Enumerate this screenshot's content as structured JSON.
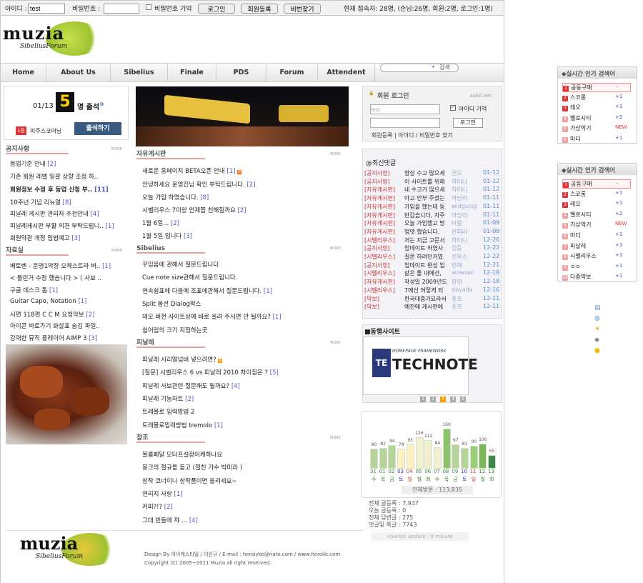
{
  "login_bar": {
    "id_label": "아이디 :",
    "id_value": "test",
    "pw_label": "비밀번호 :",
    "remember_label": "비밀번호 기억",
    "login_btn": "로그인",
    "join_btn": "회원등록",
    "find_btn": "비번찾기",
    "online": "현재 접속자: 28명, (손님:26명, 회원:2명, 로그인:1명)"
  },
  "logo": {
    "main": "muzia",
    "sub": "SibeliusForum"
  },
  "nav": [
    "Home",
    "About Us",
    "Sibelius",
    "Finale",
    "PDS",
    "Forum",
    "Attendent"
  ],
  "search_btn": "검색",
  "attend": {
    "date": "01/13",
    "count": "5",
    "suffix": "명 출석",
    "rank_no": "1등",
    "rank_name": "미주스코어닝",
    "button": "출석하기"
  },
  "more_label": "MORE",
  "notice": {
    "title": "공지사항",
    "items": [
      {
        "t": "등업기준 안내",
        "c": "[2]"
      },
      {
        "t": "기존 회원 레벨 일괄 상향 조정 하..",
        "c": ""
      },
      {
        "t": "회원정보 수정 후 등업 신청 부..",
        "c": "[11]"
      },
      {
        "t": "10주년 기념 리뉴얼",
        "c": "[8]"
      },
      {
        "t": "피날레 게시판 관리자 추천안내",
        "c": "[4]"
      },
      {
        "t": "피날레게시판 부활 의견 부탁드립니..",
        "c": "[1]"
      },
      {
        "t": "회원약관 개정 입법예고",
        "c": "[3]"
      }
    ]
  },
  "pds": {
    "title": "자료실",
    "items": [
      {
        "t": "베토벤 - 운명1악장 오케스트라 버..",
        "c": "[1]"
      },
      {
        "t": "< 틀린거 수정 했습니다 > ( 사보 ..",
        "c": ""
      },
      {
        "t": "구글 데스크 톱",
        "c": "[1]"
      },
      {
        "t": "Guitar Capo, Notation",
        "c": "[1]"
      },
      {
        "t": "시편 118편 C C M 요청악보",
        "c": "[2]"
      },
      {
        "t": "아이콘 바로가기 화살표 숨김 파일..",
        "c": ""
      },
      {
        "t": "강력한 뮤직 플레이어 AIMP 3",
        "c": "[3]"
      }
    ]
  },
  "free": {
    "title": "자유게시판",
    "items": [
      {
        "t": "새로운 홈페이지 BETA오픈 안내",
        "c": "[1]"
      },
      {
        "t": "안녕하세요 운영진님 확인 부탁드립니다.",
        "c": "[2]"
      },
      {
        "t": "오늘 가입 하였습니다.",
        "c": "[8]"
      },
      {
        "t": "시벨리우스 7이랑 언제쯤 친해질까요",
        "c": "[2]"
      },
      {
        "t": "1월 6일...",
        "c": "[2]"
      },
      {
        "t": "1월 5일 입니다",
        "c": "[3]"
      }
    ]
  },
  "sibelius": {
    "title": "Sibelius",
    "items": [
      {
        "t": "꾸밈음에 관해서 질문드립니다",
        "c": ""
      },
      {
        "t": "Cue note size관해서 질문드립니다.",
        "c": ""
      },
      {
        "t": "연속쉼표에 다음에 조표에관해서 질문드립니다.",
        "c": "[1]"
      },
      {
        "t": "Split 옵션 Dialog박스",
        "c": ""
      },
      {
        "t": "데모 버전 사이트상에 바로 올려 주시면 안 될까요?",
        "c": "[1]"
      },
      {
        "t": "쉼어림의 크기 지정하는곳",
        "c": ""
      }
    ]
  },
  "finale": {
    "title": "피날레",
    "items": [
      {
        "t": "피날레 시리얼넘버 넣으려면?",
        "c": ""
      },
      {
        "t": "[질문] 시벨리우스 6 vs 피날레 2010 차이점은 ?",
        "c": "[5]"
      },
      {
        "t": "피날레 사보관련 질문해도 될까요?",
        "c": "[4]"
      },
      {
        "t": "피날레 기능차트",
        "c": "[2]"
      },
      {
        "t": "트레몰로 입력방법 2",
        "c": ""
      },
      {
        "t": "트레몰로입력방법 tremolo",
        "c": "[1]"
      }
    ]
  },
  "creative": {
    "title": "창조",
    "items": [
      {
        "t": "볼륨페달 모터프설정어케하나요",
        "c": ""
      },
      {
        "t": "몽크의 절규를 듣고 (절친 가수 박미라 )",
        "c": ""
      },
      {
        "t": "창작 코너이니 창작품이면 올리세요~",
        "c": ""
      },
      {
        "t": "연리지 사랑",
        "c": "[1]"
      },
      {
        "t": "커피?!?",
        "c": "[2]"
      },
      {
        "t": "그대 빈들에 꺄 ...",
        "c": "[4]"
      }
    ]
  },
  "member_login": {
    "title": "회원 로그인",
    "site": "sukil.net",
    "id_value": "test",
    "remember": "아이디 기억",
    "button": "로그인",
    "links": "회원등록 | 아이디 / 비밀번호 찾기"
  },
  "recent_comments": {
    "title": "@최신댓글",
    "rows": [
      {
        "b": "[공지사항]",
        "t": "항상 수고 많으세",
        "u": "권오",
        "d": "01-12"
      },
      {
        "b": "[공지사항]",
        "t": "이 사이트를 위해",
        "u": "하미니",
        "d": "01-12"
      },
      {
        "b": "[자유게시판]",
        "t": "네 수고가 많으세",
        "u": "하미니",
        "d": "01-12"
      },
      {
        "b": "[자유게시판]",
        "t": "아고 안부 주셨는",
        "u": "마당리",
        "d": "01-11"
      },
      {
        "b": "[자유게시판]",
        "t": "가입을 했는데 등",
        "u": "widgusig",
        "d": "01-11"
      },
      {
        "b": "[자유게시판]",
        "t": "반갑습니다, 자주",
        "u": "마당리",
        "d": "01-11"
      },
      {
        "b": "[자유게시판]",
        "t": "오늘 가입했고 방",
        "u": "바람",
        "d": "01-09"
      },
      {
        "b": "[자유게시판]",
        "t": "업뎃 했습니다.",
        "u": "온피라",
        "d": "01-08"
      },
      {
        "b": "[시벨리우스]",
        "t": "저는 지금 고문서",
        "u": "하미니",
        "d": "12-26"
      },
      {
        "b": "[공지사항]",
        "t": "업데이트 하였사",
        "u": "검동",
        "d": "12-22"
      },
      {
        "b": "[시벨리우스]",
        "t": "질문 하려던거였",
        "u": "전욱스",
        "d": "12-22"
      },
      {
        "b": "[공지사항]",
        "t": "업데이트 완성 입",
        "u": "번해",
        "d": "12-21"
      },
      {
        "b": "[시벨리우스]",
        "t": "같은 툴 내에선,",
        "u": "wowsan",
        "d": "12-18"
      },
      {
        "b": "[자유게시판]",
        "t": "작성일 2009년도",
        "u": "함명",
        "d": "12-18"
      },
      {
        "b": "[시벨리우스]",
        "t": "7에선 어떻게 되",
        "u": "doyada",
        "d": "12-16"
      },
      {
        "b": "[악보]",
        "t": "한국대중가요라서",
        "u": "쥬프",
        "d": "12-11"
      },
      {
        "b": "[악보]",
        "t": "예전에 게시판에",
        "u": "쥬프",
        "d": "12-11"
      }
    ]
  },
  "partner": {
    "title": "■동행사이트",
    "banner_top": "HOMEPAGE FRAMEWORK",
    "banner_main": "TECHNOTE",
    "pages": [
      "1",
      "2",
      "3",
      "4",
      "5"
    ]
  },
  "visit_chart": {
    "days": [
      "31",
      "01",
      "02",
      "03",
      "04",
      "05",
      "06",
      "07",
      "08",
      "09",
      "10",
      "11",
      "12",
      "13"
    ],
    "weekdays": [
      "수",
      "목",
      "금",
      "토",
      "일",
      "월",
      "화",
      "수",
      "목",
      "금",
      "토",
      "일",
      "월",
      "화"
    ],
    "values": [
      80,
      82,
      94,
      78,
      95,
      126,
      112,
      84,
      160,
      97,
      81,
      90,
      100,
      55
    ],
    "total": "전체방문 : 113,835"
  },
  "stats": {
    "l1": "전체 글등록 : 7,937",
    "l2": "오늘 글등록 : 0",
    "l3": "전체 답변글 : 275",
    "l4": "댓글및 쪽글 : 7743",
    "update": "counter update : 0 minute"
  },
  "popular1": {
    "title": "실시간 인기 검색어",
    "items": [
      {
        "n": "1",
        "t": "공동구매",
        "v": "–"
      },
      {
        "n": "2",
        "t": "스코롱",
        "v": "+1"
      },
      {
        "n": "3",
        "t": "레오",
        "v": "+1"
      },
      {
        "n": "4",
        "t": "벨로시티",
        "v": "+2"
      },
      {
        "n": "5",
        "t": "가상악기",
        "v": "NEW"
      },
      {
        "n": "6",
        "t": "마디",
        "v": "+1"
      }
    ]
  },
  "popular2": {
    "title": "실시간 인기 검색어",
    "items": [
      {
        "n": "1",
        "t": "공동구매",
        "v": "–"
      },
      {
        "n": "2",
        "t": "스코롱",
        "v": "+1"
      },
      {
        "n": "3",
        "t": "레오",
        "v": "+1"
      },
      {
        "n": "4",
        "t": "벨로시티",
        "v": "+2"
      },
      {
        "n": "5",
        "t": "가상악기",
        "v": "NEW"
      },
      {
        "n": "6",
        "t": "마디",
        "v": "+1"
      },
      {
        "n": "7",
        "t": "피날레",
        "v": "+1"
      },
      {
        "n": "8",
        "t": "시벨리우스",
        "v": "+1"
      },
      {
        "n": "9",
        "t": "ㅇㅇ",
        "v": "+1"
      },
      {
        "n": "10",
        "t": "다중악보",
        "v": "+1"
      }
    ]
  },
  "footer": {
    "design": "Design By 아이케스타일 / 이인규 / E-mail : heroiyke@nate.com / www.herolik.com",
    "copyright": "Copyright (C) 2005~2011 Muzia all right reserved."
  }
}
